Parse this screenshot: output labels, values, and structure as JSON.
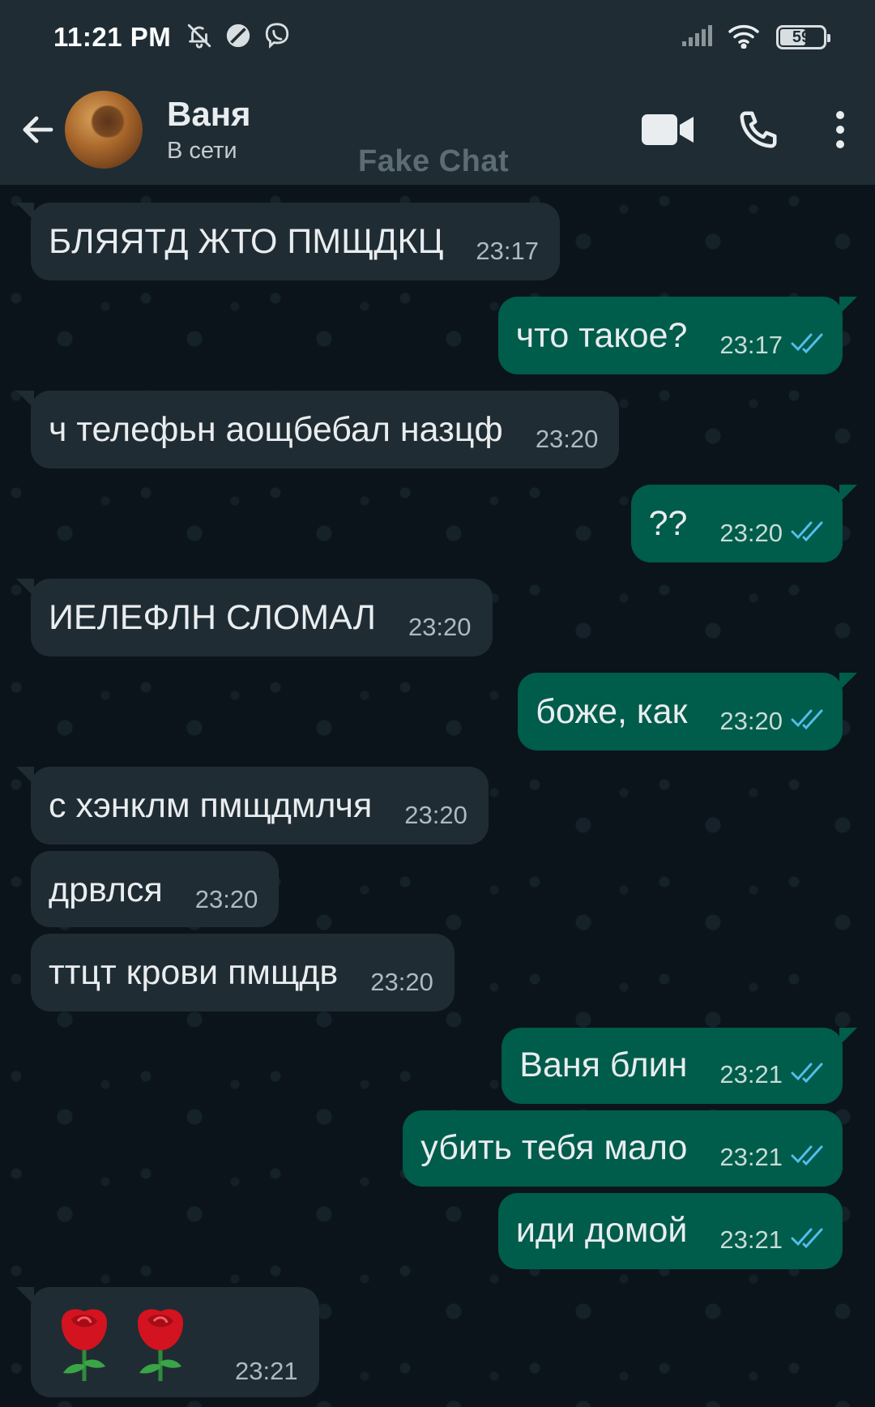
{
  "status_bar": {
    "time": "11:21 PM",
    "left_icons": [
      "bell-off-icon",
      "do-not-disturb-icon",
      "viber-icon"
    ],
    "right_icons": [
      "signal-icon",
      "wifi-icon",
      "battery-icon"
    ],
    "battery_percent": "59",
    "battery_level": 0.59
  },
  "header": {
    "contact_name": "Ваня",
    "contact_status": "В сети",
    "watermark": "Fake Chat",
    "icons": [
      "back-arrow-icon",
      "video-call-icon",
      "phone-call-icon",
      "more-options-icon"
    ]
  },
  "colors": {
    "background": "#0b141a",
    "header": "#1f2c34",
    "incoming_bubble": "#202c33",
    "outgoing_bubble": "#005c4b",
    "read_ticks": "#53bdeb"
  },
  "messages": [
    {
      "dir": "in",
      "text": "БЛЯЯТД ЖТО ПМЩДКЦ",
      "time": "23:17"
    },
    {
      "dir": "out",
      "text": "что такое?",
      "time": "23:17",
      "status": "read"
    },
    {
      "dir": "in",
      "text": "ч телефьн аощбебал назцф",
      "time": "23:20"
    },
    {
      "dir": "out",
      "text": "??",
      "time": "23:20",
      "status": "read"
    },
    {
      "dir": "in",
      "text": "ИЕЛЕФЛН СЛОМАЛ",
      "time": "23:20"
    },
    {
      "dir": "out",
      "text": "боже, как",
      "time": "23:20",
      "status": "read"
    },
    {
      "dir": "in",
      "text": "с хэнклм пмщдмлчя",
      "time": "23:20"
    },
    {
      "dir": "in",
      "text": "дрвлся",
      "time": "23:20"
    },
    {
      "dir": "in",
      "text": "ттцт крови пмщдв",
      "time": "23:20"
    },
    {
      "dir": "out",
      "text": "Ваня блин",
      "time": "23:21",
      "status": "read"
    },
    {
      "dir": "out",
      "text": "убить тебя мало",
      "time": "23:21",
      "status": "read"
    },
    {
      "dir": "out",
      "text": "иди домой",
      "time": "23:21",
      "status": "read"
    },
    {
      "dir": "in",
      "text": "",
      "emoji": [
        "rose-emoji",
        "rose-emoji"
      ],
      "time": "23:21"
    }
  ]
}
